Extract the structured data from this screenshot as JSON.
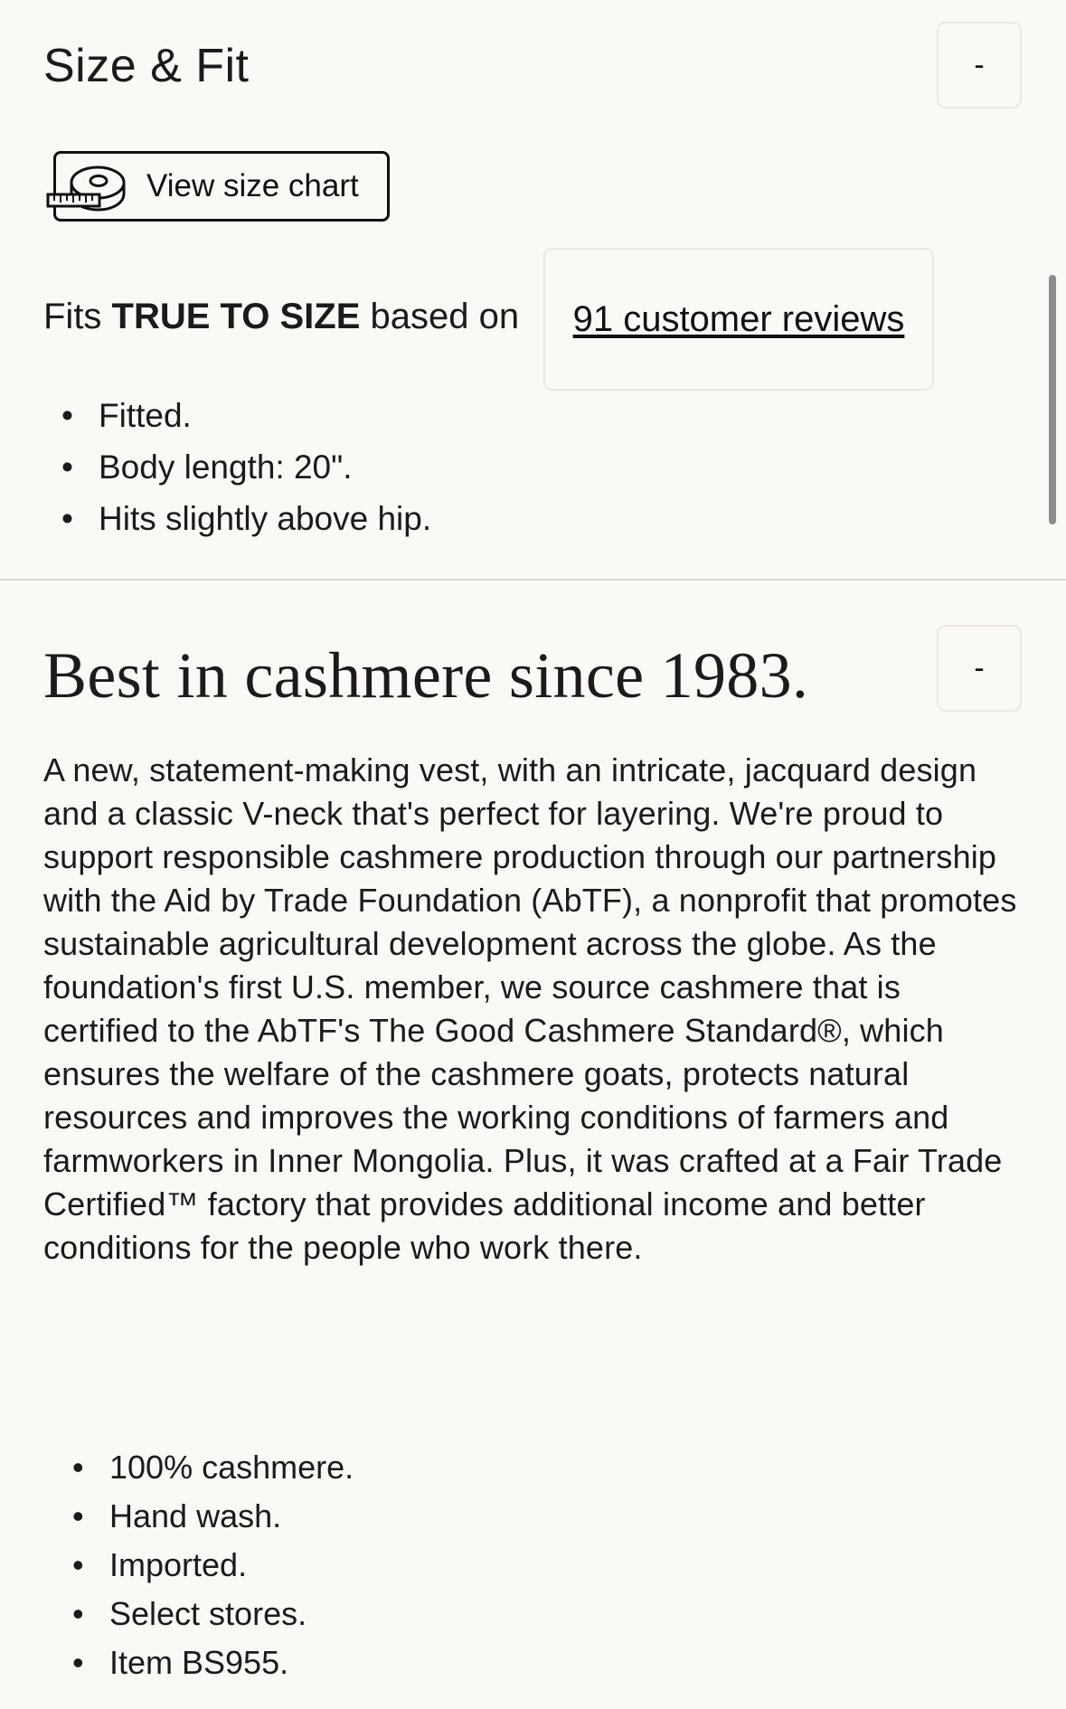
{
  "size_fit": {
    "title": "Size & Fit",
    "toggle_label": "-",
    "size_chart_label": "View size chart",
    "fit_prefix": "Fits ",
    "fit_emphasis": "TRUE TO SIZE",
    "fit_suffix": " based on",
    "reviews_link": "91 customer reviews",
    "details": [
      "Fitted.",
      "Body length: 20\".",
      "Hits slightly above hip."
    ]
  },
  "cashmere": {
    "title": "Best in cashmere since 1983.",
    "toggle_label": "-",
    "description": "A new, statement-making vest, with an intricate, jacquard design and a classic V-neck that's perfect for layering. We're proud to support responsible cashmere production through our partnership with the Aid by Trade Foundation (AbTF), a nonprofit that promotes sustainable agricultural development across the globe. As the foundation's first U.S. member, we source cashmere that is certified to the AbTF's The Good Cashmere Standard®, which ensures the welfare of the cashmere goats, protects natural resources and improves the working conditions of farmers and farmworkers in Inner Mongolia. Plus, it was crafted at a Fair Trade Certified™ factory that provides additional income and better conditions for the people who work there.",
    "details": [
      "100% cashmere.",
      "Hand wash.",
      "Imported.",
      "Select stores.",
      "Item BS955."
    ]
  },
  "icons": {
    "tape_measure": "tape-measure-icon",
    "bullet": "•"
  },
  "colors": {
    "background": "#fbf9f6",
    "text": "#1b1b1b",
    "border": "#ebe7e2",
    "divider": "#dcd8d4",
    "scrollbar": "#8d8d8d"
  }
}
